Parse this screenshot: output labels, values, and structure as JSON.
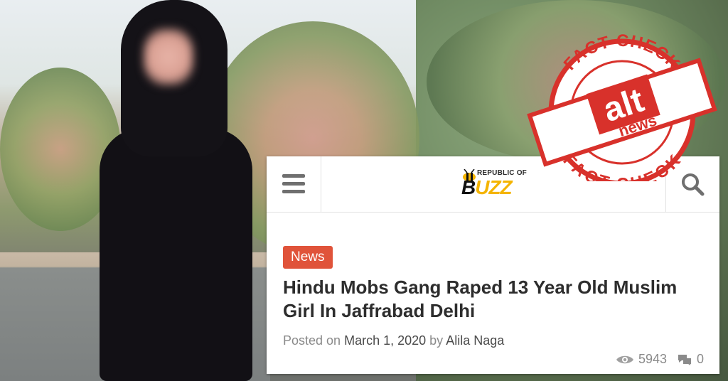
{
  "header": {
    "logo_small": "REPUBLIC OF",
    "logo_part1": "B",
    "logo_part2": "UZZ"
  },
  "article": {
    "category": "News",
    "title": "Hindu Mobs Gang Raped 13 Year Old Muslim Girl In Jaffrabad Delhi",
    "posted_prefix": "Posted on",
    "date": "March 1, 2020",
    "by_prefix": "by",
    "author": "Alila Naga",
    "views": "5943",
    "comments": "0"
  },
  "stamp": {
    "top_text": "FACT-CHECK",
    "bottom_text": "FACT-CHECK",
    "logo_alt": "alt",
    "logo_news": "news"
  },
  "colors": {
    "accent": "#e0533a",
    "stamp_red": "#d8312b",
    "logo_yellow": "#f4b400"
  },
  "icons": [
    "hamburger-menu-icon",
    "search-icon",
    "eye-icon",
    "comment-icon",
    "bee-icon"
  ]
}
